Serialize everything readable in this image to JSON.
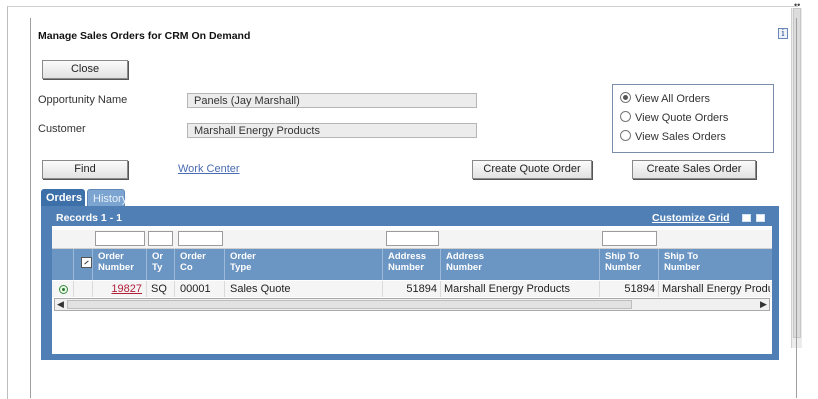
{
  "dialog": {
    "title": "Manage Sales Orders for CRM On Demand",
    "info_icon": "info-icon"
  },
  "buttons": {
    "close": "Close",
    "find": "Find",
    "create_quote": "Create Quote Order",
    "create_sales": "Create Sales Order"
  },
  "form": {
    "opportunity_label": "Opportunity Name",
    "opportunity_value": "Panels (Jay Marshall)",
    "customer_label": "Customer",
    "customer_value": "Marshall Energy Products",
    "work_center_link": "Work Center"
  },
  "view_options": [
    {
      "label": "View All Orders",
      "selected": true
    },
    {
      "label": "View Quote Orders",
      "selected": false
    },
    {
      "label": "View Sales Orders",
      "selected": false
    }
  ],
  "tabs": [
    {
      "label": "Orders",
      "active": true
    },
    {
      "label": "History",
      "active": false
    }
  ],
  "grid": {
    "records_label": "Records 1 - 1",
    "customize_label": "Customize Grid",
    "headers": [
      {
        "l1": "Order",
        "l2": "Number"
      },
      {
        "l1": "Or",
        "l2": "Ty"
      },
      {
        "l1": "Order",
        "l2": "Co"
      },
      {
        "l1": "Order",
        "l2": "Type"
      },
      {
        "l1": "Address",
        "l2": "Number"
      },
      {
        "l1": "Address",
        "l2": "Number"
      },
      {
        "l1": "Ship To",
        "l2": "Number"
      },
      {
        "l1": "Ship To",
        "l2": "Number"
      }
    ],
    "rows": [
      {
        "order_number": "19827",
        "order_type": "SQ",
        "order_co": "00001",
        "order_type_desc": "Sales Quote",
        "address_number": "51894",
        "address_name": "Marshall Energy Products",
        "ship_to_number": "51894",
        "ship_to_name": "Marshall Energy Produ"
      }
    ]
  },
  "colors": {
    "grid_blue": "#4f7fb4",
    "header_blue": "#6b95c2",
    "tab_active": "#3d6fa8",
    "link": "#4a6cb3",
    "order_link": "#b0203a"
  }
}
